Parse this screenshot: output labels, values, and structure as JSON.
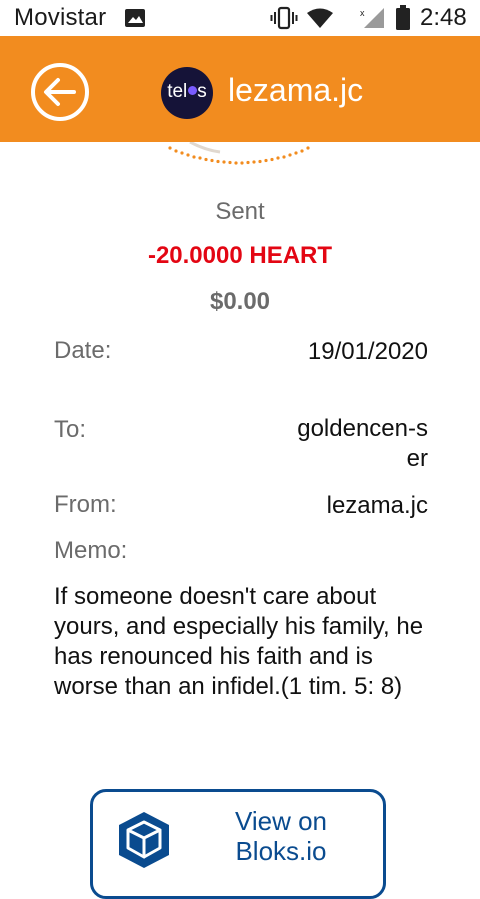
{
  "status_bar": {
    "carrier": "Movistar",
    "time": "2:48",
    "icons": [
      "image-icon",
      "vibrate-icon",
      "wifi-icon",
      "signal-icon",
      "battery-icon"
    ]
  },
  "app_bar": {
    "title": "lezama.jc",
    "logo": {
      "before_dot": "tel",
      "after_dot": "s",
      "dot_color": "#7a5cff"
    },
    "background_color": "#f28c1f"
  },
  "transaction": {
    "type": "Sent",
    "amount": "-20.0000 HEART",
    "amount_color": "#e30613",
    "fiat_value": "$0.00",
    "date_label": "Date:",
    "date_value": "19/01/2020",
    "to_label": "To:",
    "to_value": "goldencen-ser",
    "from_label": "From:",
    "from_value": "lezama.jc",
    "memo_label": "Memo:",
    "memo_text": "If someone doesn't care about yours, and especially his family, he has renounced his faith and is worse than an infidel.(1 tim. 5: 8)"
  },
  "actions": {
    "bloks_label": "View on Bloks.io",
    "bloks_color": "#0a4b8f"
  }
}
